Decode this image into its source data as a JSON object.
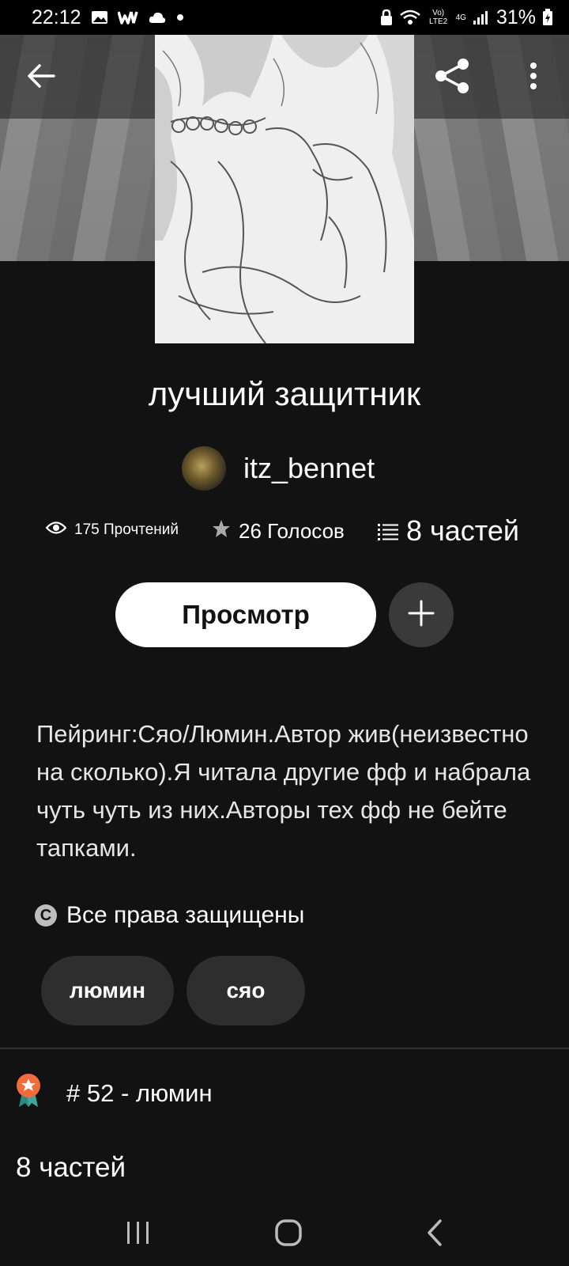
{
  "status_bar": {
    "time": "22:12",
    "battery": "31%",
    "network": "Vo) LTE2",
    "signal": "4G"
  },
  "story": {
    "title": "лучший защитник",
    "author": "itz_bennet",
    "reads": "175 Прочтений",
    "votes": "26 Голосов",
    "parts": "8 частей",
    "read_button": "Просмотр",
    "description": "Пейринг:Сяо/Люмин.Автор жив(неизвестно на сколько).Я читала другие фф и набрала чуть чуть из них.Авторы тех фф не бейте тапками.",
    "copyright": "Все права защищены",
    "copyright_symbol": "C",
    "tags": [
      "люмин",
      "сяо"
    ],
    "rank": "# 52 - люмин",
    "parts_footer": "8 частей"
  },
  "colors": {
    "background": "#121212",
    "button_primary": "#ffffff",
    "button_secondary": "#3a3a3a",
    "tag_bg": "#2e2e2e",
    "rank_badge": "#f26b3a"
  },
  "icons": {
    "back": "arrow-left-icon",
    "share": "share-icon",
    "more": "more-vertical-icon",
    "reads": "eye-icon",
    "votes": "star-icon",
    "parts": "list-icon",
    "add": "plus-icon",
    "copyright": "copyright-icon",
    "rank": "award-badge-icon"
  }
}
